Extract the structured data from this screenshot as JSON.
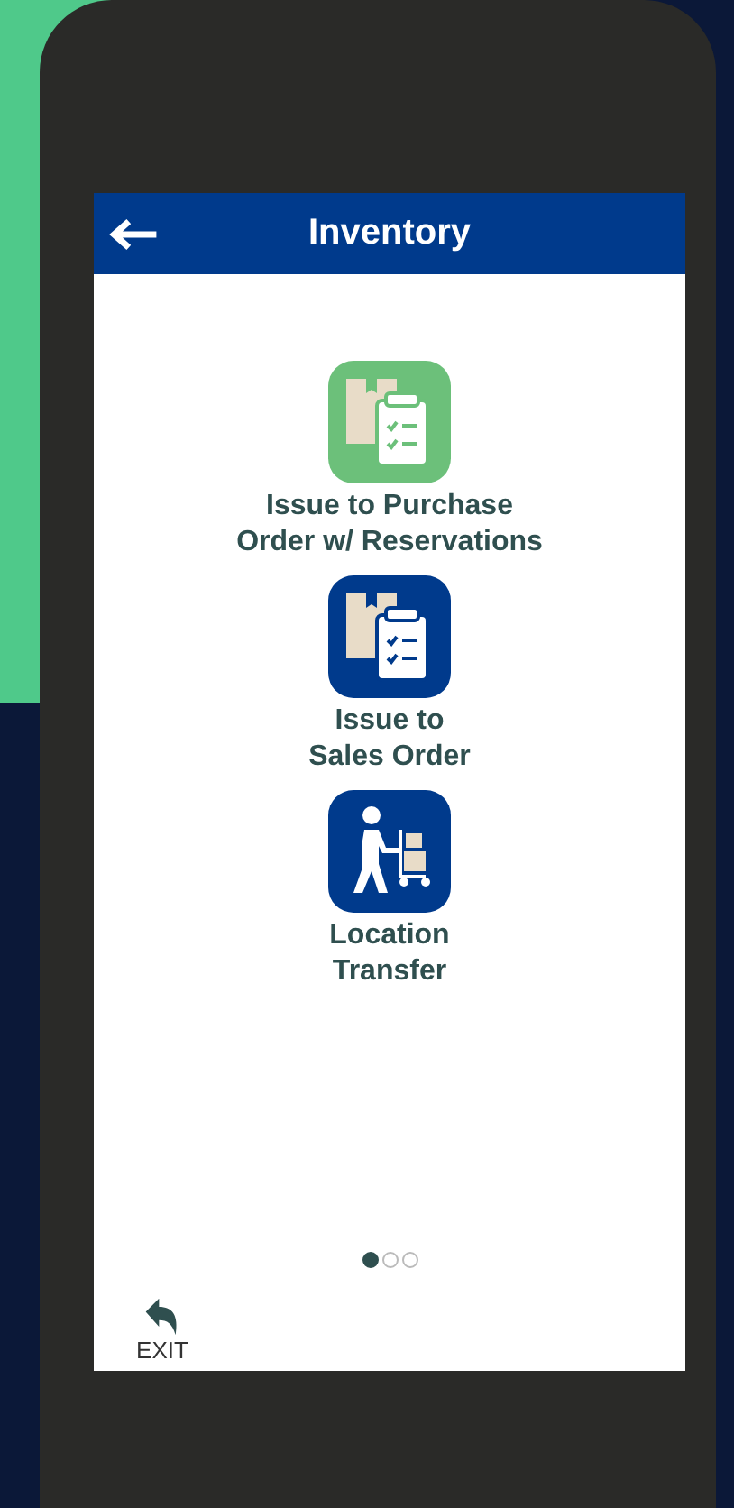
{
  "header": {
    "title": "Inventory"
  },
  "menu_items": [
    {
      "label_lines": [
        "Issue to Purchase",
        "Order w/ Reservations"
      ],
      "kind": "clipboard",
      "color": "#6cc07a"
    },
    {
      "label_lines": [
        "Issue to",
        "Sales Order"
      ],
      "kind": "clipboard",
      "color": "#003a8c"
    },
    {
      "label_lines": [
        "Location",
        "Transfer"
      ],
      "kind": "trolley",
      "color": "#003a8c"
    }
  ],
  "pager": [
    {
      "selected": true
    },
    {
      "selected": false
    },
    {
      "selected": false
    }
  ],
  "exit": {
    "label": "EXIT"
  }
}
